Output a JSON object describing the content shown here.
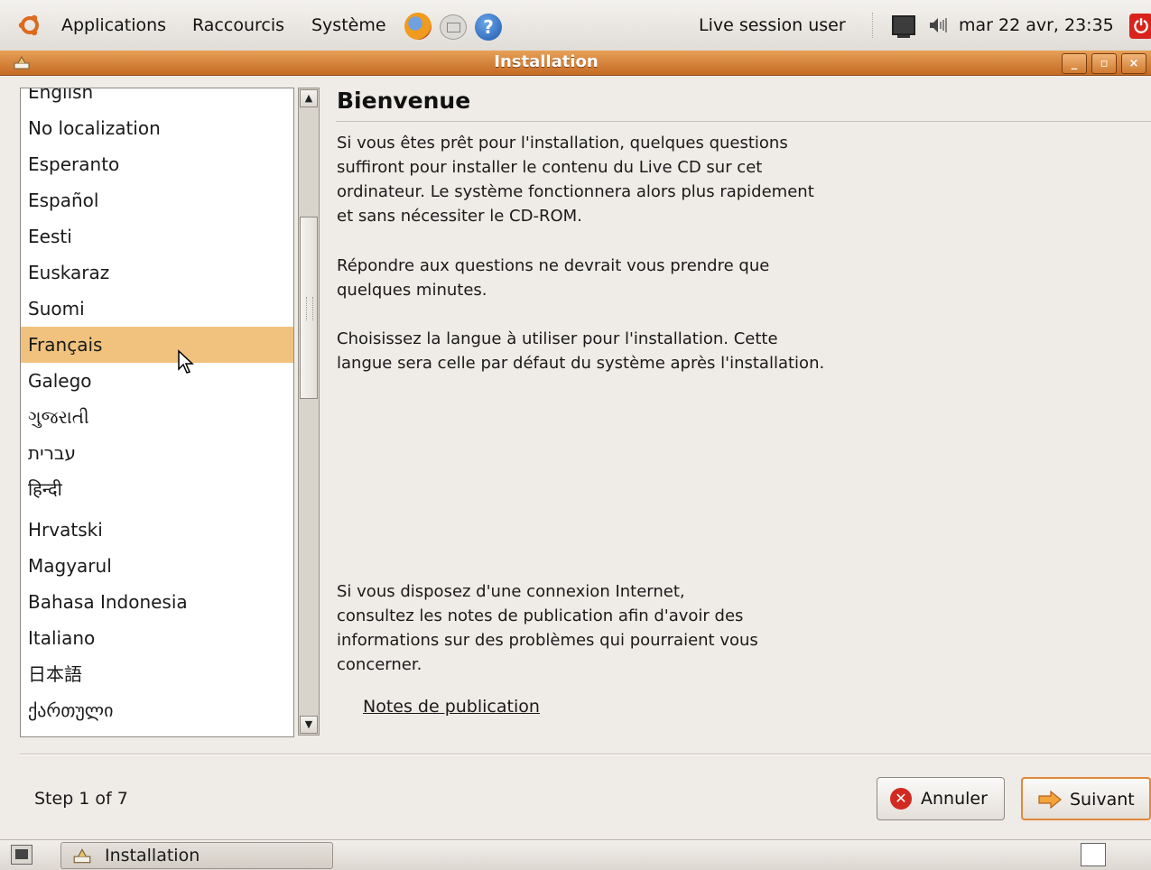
{
  "top_panel": {
    "menu_applications": "Applications",
    "menu_shortcuts": "Raccourcis",
    "menu_system": "Système",
    "user": "Live session user",
    "datetime": "mar 22 avr, 23:35"
  },
  "window": {
    "title": "Installation"
  },
  "language_list": {
    "items": [
      "English",
      "No localization",
      "Esperanto",
      "Español",
      "Eesti",
      "Euskaraz",
      "Suomi",
      "Français",
      "Galego",
      "ગુજરાતી",
      "עברית",
      "हिन्दी",
      "Hrvatski",
      "Magyarul",
      "Bahasa Indonesia",
      "Italiano",
      "日本語",
      "ქართული"
    ],
    "selected": "Français"
  },
  "content": {
    "heading": "Bienvenue",
    "para1": "Si vous êtes prêt pour l'installation, quelques questions\nsuffiront pour installer le contenu du Live CD sur cet\nordinateur. Le système fonctionnera alors plus rapidement\net sans nécessiter le CD-ROM.",
    "para2": "Répondre aux questions ne devrait vous prendre que\nquelques minutes.",
    "para3": "Choisissez la langue à utiliser pour l'installation. Cette\nlangue sera celle par défaut du système après l'installation.",
    "para4": "Si vous disposez d'une connexion Internet,\nconsultez les notes de publication afin d'avoir des\ninformations sur des problèmes qui pourraient vous\nconcerner.",
    "notes_link": "Notes de publication"
  },
  "footer": {
    "step": "Step 1 of 7",
    "cancel_label": "Annuler",
    "next_label": "Suivant"
  },
  "taskbar": {
    "task_label": "Installation"
  },
  "colors": {
    "titlebar": "#c56a23",
    "selection": "#f1c27e",
    "default_button_border": "#e0883a"
  }
}
